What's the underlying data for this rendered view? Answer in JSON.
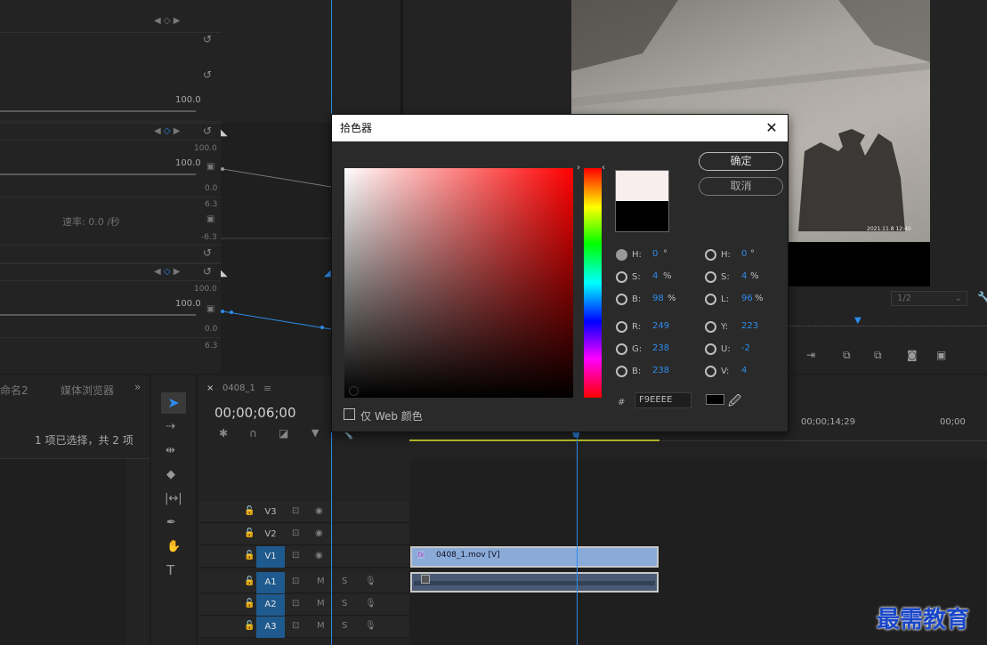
{
  "effect_controls": {
    "val_100_a": "100.0",
    "val_100_b": "100.0",
    "val_100_c": "100.0",
    "val_100_d": "100.0",
    "val_100_e": "100.0",
    "val_0_a": "0.0",
    "val_63_a": "6.3",
    "val_neg63": "-6.3",
    "val_0_b": "0.0",
    "val_63_b": "6.3",
    "speed_label": "速率: 0.0 /秒"
  },
  "program_monitor": {
    "timestamp_watermark": "2021.11.8 12:40",
    "zoom_select": "1/2"
  },
  "project": {
    "tab_name": "命名2",
    "tab_media_browser": "媒体浏览器",
    "selection_status": "1 项已选择，共 2 项"
  },
  "timeline": {
    "tab_name": "0408_1",
    "timecode": "00;00;06;00",
    "ruler_mark_1": "00;00;14;29",
    "ruler_mark_2": "00;00",
    "tracks": [
      {
        "name": "V3",
        "active": false
      },
      {
        "name": "V2",
        "active": false
      },
      {
        "name": "V1",
        "active": true
      },
      {
        "name": "A1",
        "active": true
      },
      {
        "name": "A2",
        "active": true
      },
      {
        "name": "A3",
        "active": true
      }
    ],
    "clip_label": "0408_1.mov [V]",
    "fx_badge": "fx"
  },
  "color_picker": {
    "title": "拾色器",
    "ok_label": "确定",
    "cancel_label": "取消",
    "web_only_label": "仅 Web 颜色",
    "hex_prefix": "#",
    "hex_value": "F9EEEE",
    "new_color": "#f9eeee",
    "old_color": "#000000",
    "left_fields": [
      {
        "label": "H:",
        "value": "0",
        "unit": "°"
      },
      {
        "label": "S:",
        "value": "4",
        "unit": "%"
      },
      {
        "label": "B:",
        "value": "98",
        "unit": "%"
      },
      {
        "label": "R:",
        "value": "249",
        "unit": ""
      },
      {
        "label": "G:",
        "value": "238",
        "unit": ""
      },
      {
        "label": "B:",
        "value": "238",
        "unit": ""
      }
    ],
    "right_fields": [
      {
        "label": "H:",
        "value": "0",
        "unit": "°"
      },
      {
        "label": "S:",
        "value": "4",
        "unit": "%"
      },
      {
        "label": "L:",
        "value": "96",
        "unit": "%"
      },
      {
        "label": "Y:",
        "value": "223",
        "unit": ""
      },
      {
        "label": "U:",
        "value": "-2",
        "unit": ""
      },
      {
        "label": "V:",
        "value": "4",
        "unit": ""
      }
    ]
  },
  "watermark_logo": "最需教育"
}
